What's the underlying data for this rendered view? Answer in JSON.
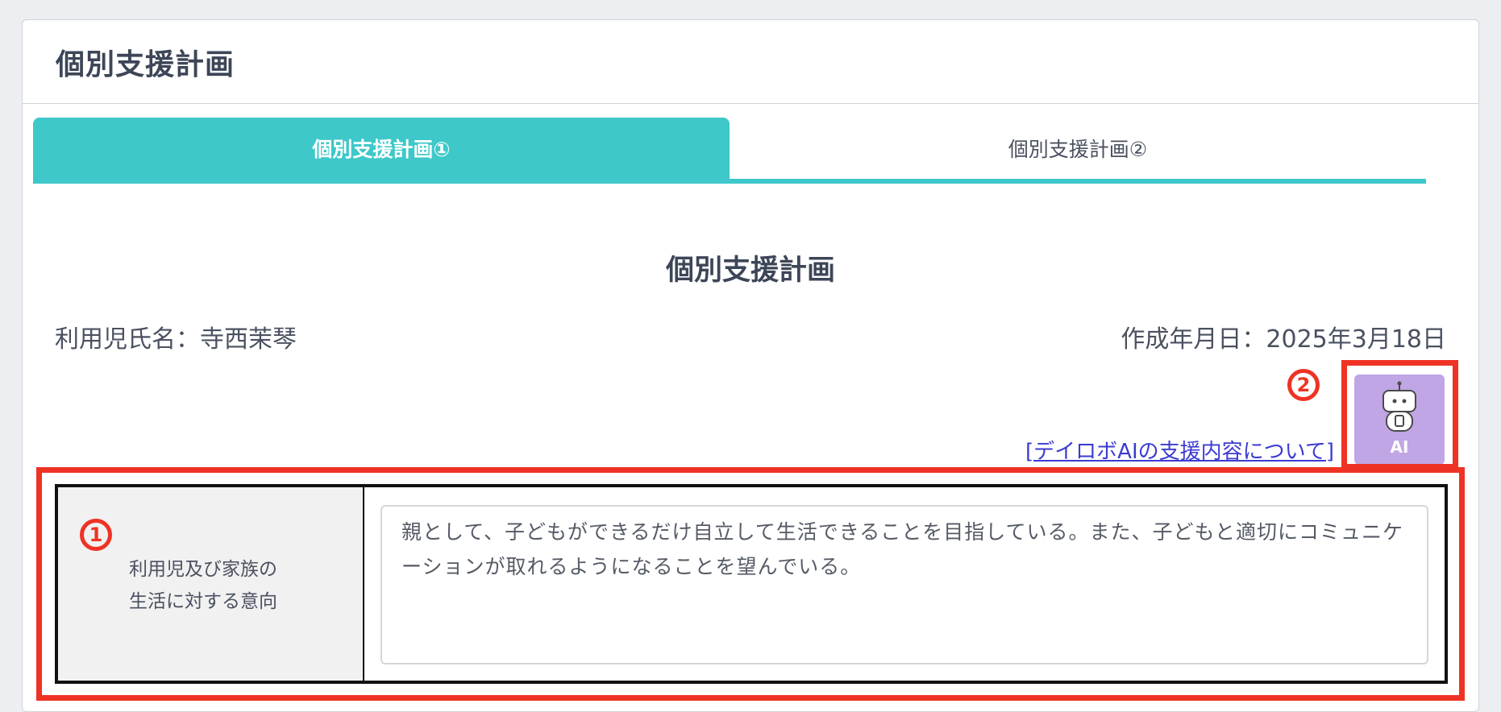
{
  "header": {
    "title": "個別支援計画"
  },
  "tabs": [
    {
      "label": "個別支援計画①",
      "active": true
    },
    {
      "label": "個別支援計画②",
      "active": false
    }
  ],
  "main": {
    "section_title": "個別支援計画",
    "child_name": "利用児氏名：寺西茉琴",
    "created_date": "作成年月日：2025年3月18日",
    "ai_link": "[デイロボAIの支援内容について]",
    "ai_button": {
      "label": "AI",
      "icon": "robot-icon"
    },
    "field": {
      "label_line1": "利用児及び家族の",
      "label_line2": "生活に対する意向",
      "value": "親として、子どもができるだけ自立して生活できることを目指している。また、子どもと適切にコミュニケーションが取れるようになることを望んでいる。"
    }
  },
  "annotations": {
    "marker1": "1",
    "marker2": "2",
    "color": "#ee3324"
  },
  "colors": {
    "accent": "#3ec8c9",
    "ai_button": "#c0a6e4",
    "link": "#3b3bd2"
  }
}
